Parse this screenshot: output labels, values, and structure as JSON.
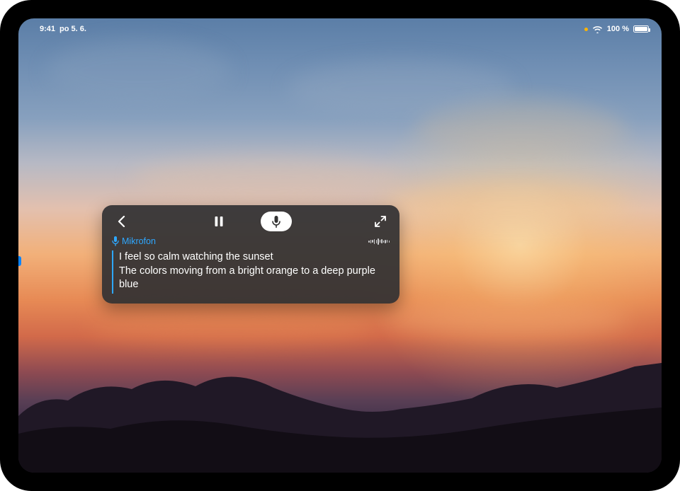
{
  "status": {
    "time": "9:41",
    "date": "po 5. 6.",
    "battery_text": "100 %"
  },
  "caption": {
    "label": "Mikrofon",
    "lines": [
      "I feel so calm watching the sunset",
      "The colors moving from a bright orange to a deep purple blue"
    ]
  }
}
